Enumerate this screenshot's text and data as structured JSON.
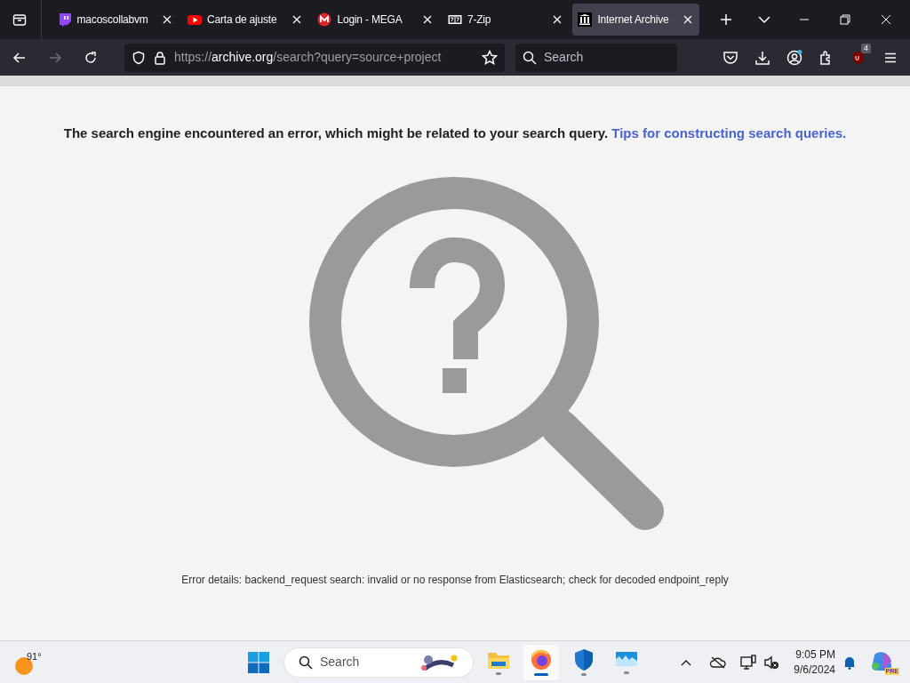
{
  "tabs": [
    {
      "title": "macoscollabvm",
      "kind": "twitch",
      "selected": false
    },
    {
      "title": "Carta de ajuste",
      "kind": "youtube",
      "selected": false
    },
    {
      "title": "Login - MEGA",
      "kind": "mega",
      "selected": false
    },
    {
      "title": "7-Zip",
      "kind": "sevenzip",
      "selected": false
    },
    {
      "title": "Internet Archive",
      "kind": "archive",
      "selected": true
    }
  ],
  "address_bar": {
    "scheme": "https://",
    "host": "archive.org",
    "path": "/search?query=source+project"
  },
  "search_field": {
    "placeholder": "Search"
  },
  "extensions_badge": "4",
  "page": {
    "message": "The search engine encountered an error, which might be related to your search query.",
    "link": "Tips for constructing search queries.",
    "error_details": "Error details: backend_request search: invalid or no response from Elasticsearch; check for decoded endpoint_reply"
  },
  "taskbar": {
    "weather": "91°",
    "search_placeholder": "Search",
    "apps": [
      {
        "kind": "folder",
        "active": false
      },
      {
        "kind": "firefox",
        "active": true
      },
      {
        "kind": "shield",
        "active": false
      },
      {
        "kind": "monitor",
        "active": false
      }
    ],
    "time": "9:05 PM",
    "date": "9/6/2024",
    "copilot_badge": "PRE"
  }
}
